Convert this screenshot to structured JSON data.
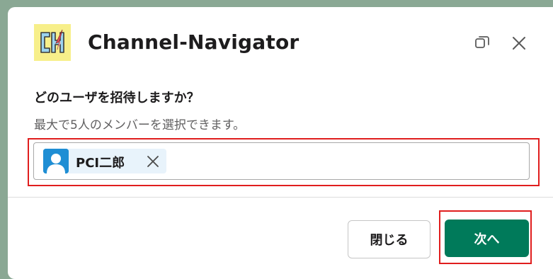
{
  "app": {
    "title": "Channel-Navigator",
    "icon": "channel-navigator-logo"
  },
  "header": {
    "popout_icon": "popout-icon",
    "close_icon": "close-icon"
  },
  "form": {
    "question": "どのユーザを招待しますか？",
    "hint": "最大で5人のメンバーを選択できます。",
    "selected_users": [
      {
        "name": "PCI二郎",
        "avatar_icon": "user-avatar-icon"
      }
    ]
  },
  "footer": {
    "close_label": "閉じる",
    "next_label": "次へ"
  },
  "colors": {
    "primary": "#007a5a",
    "highlight": "#e01e1e",
    "chip_bg": "#e8f3fb",
    "avatar_bg": "#1f8ed4"
  }
}
